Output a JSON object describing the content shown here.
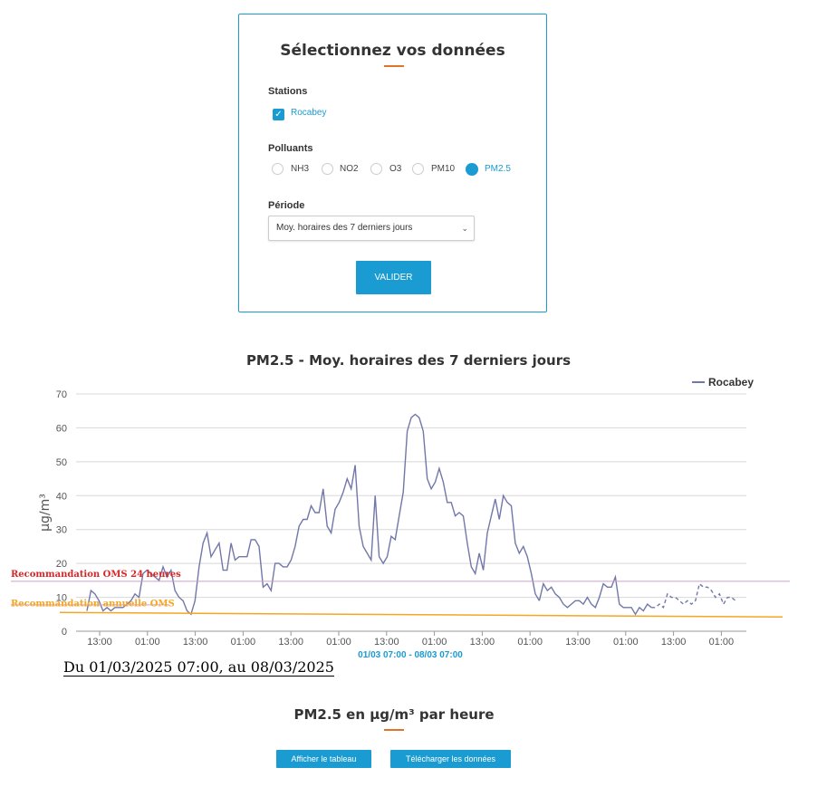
{
  "form": {
    "title": "Sélectionnez vos données",
    "stations_label": "Stations",
    "station": {
      "name": "Rocabey",
      "checked": true
    },
    "polluants_label": "Polluants",
    "polluants": [
      {
        "name": "NH3",
        "selected": false
      },
      {
        "name": "NO2",
        "selected": false
      },
      {
        "name": "O3",
        "selected": false
      },
      {
        "name": "PM10",
        "selected": false
      },
      {
        "name": "PM2.5",
        "selected": true
      }
    ],
    "periode_label": "Période",
    "periode_value": "Moy. horaires des 7 derniers jours",
    "submit_label": "VALIDER",
    "check_glyph": "✓",
    "chevron_glyph": "⌄"
  },
  "colors": {
    "accent": "#1a9bd1",
    "underline": "#e2732b",
    "series": "#7177a8",
    "oms24": "#d62728",
    "oms_annual": "#f5a623"
  },
  "chart_data": {
    "type": "line",
    "title": "PM2.5 - Moy. horaires des 7 derniers jours",
    "ylabel": "µg/m³",
    "ylim": [
      0,
      70
    ],
    "yticks": [
      0,
      10,
      20,
      30,
      40,
      50,
      60,
      70
    ],
    "x_tick_labels": [
      "13:00",
      "01:00",
      "13:00",
      "01:00",
      "13:00",
      "01:00",
      "13:00",
      "01:00",
      "13:00",
      "01:00",
      "13:00",
      "01:00",
      "13:00",
      "01:00"
    ],
    "x_range_label": "01/03 07:00 - 08/03 07:00",
    "legend": {
      "position": "top-right"
    },
    "grid": true,
    "series": [
      {
        "name": "Rocabey",
        "solid": [
          6,
          12,
          11,
          9,
          6,
          7,
          6,
          7,
          7,
          7,
          8,
          9,
          11,
          10,
          17,
          18,
          17,
          16,
          15,
          19,
          16,
          18,
          12,
          10,
          9,
          6,
          5,
          9,
          19,
          26,
          29,
          22,
          24,
          26,
          18,
          18,
          26,
          21,
          22,
          22,
          22,
          27,
          27,
          25,
          13,
          14,
          12,
          20,
          20,
          19,
          19,
          21,
          25,
          31,
          33,
          33,
          37,
          35,
          35,
          42,
          31,
          29,
          36,
          38,
          41,
          45,
          42,
          49,
          31,
          25,
          23,
          21,
          40,
          22,
          20,
          22,
          28,
          27,
          34,
          41,
          59,
          63,
          64,
          63,
          59,
          45,
          42,
          44,
          48,
          44,
          38,
          38,
          34,
          35,
          34,
          26,
          19,
          17,
          23,
          18,
          29,
          34,
          39,
          33,
          40,
          38,
          37,
          26,
          23,
          25,
          22,
          17,
          11,
          9
        ],
        "solid_b": [
          14,
          12,
          13,
          11,
          10,
          8,
          7,
          8,
          9,
          9,
          8,
          10,
          8,
          7,
          10,
          14,
          13,
          13,
          16,
          8,
          7,
          7,
          7,
          5,
          7,
          6,
          8,
          7
        ],
        "dashed": [
          7,
          8,
          7,
          11,
          10,
          10,
          9,
          8,
          9,
          8,
          9,
          14,
          13,
          13,
          12,
          10,
          11,
          8,
          10,
          10,
          9
        ]
      }
    ],
    "reference_lines": [
      {
        "label": "Recommandation OMS 24 heures",
        "value": 15
      },
      {
        "label": "Recommandation annuelle OMS",
        "value": 5
      }
    ]
  },
  "period_text": "Du 01/03/2025 07:00,  au 08/03/2025",
  "section2_title": "PM2.5 en µg/m³ par heure",
  "buttons": {
    "show_table": "Afficher le tableau",
    "download": "Télécharger les données"
  }
}
